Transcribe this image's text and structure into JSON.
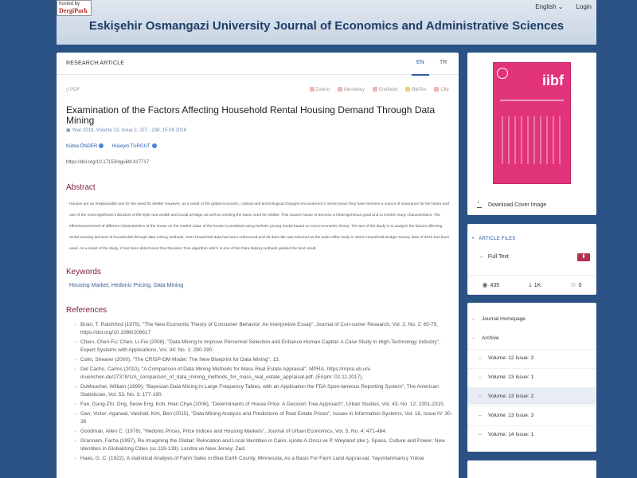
{
  "header": {
    "logo_line1": "hosted by",
    "logo_line2": "DergiPark",
    "journal_title": "Eskişehir Osmangazi University Journal of Economics and Administrative Sciences",
    "language": "English",
    "login": "Login"
  },
  "article": {
    "type": "RESEARCH ARTICLE",
    "tab_en": "EN",
    "tab_tr": "TR",
    "pdf": "PDF",
    "cite_tools": [
      "Zotero",
      "Mendeley",
      "EndNote",
      "BibTex",
      "Cite"
    ],
    "title": "Examination of the Factors Affecting Household Rental Housing Demand Through Data Mining",
    "meta": "Year 2018, Volume 13, Issue 2, 227 - 238, 15.08.2018",
    "authors": [
      "Kübra ÖNDER",
      "Hüseyin TURGUT"
    ],
    "doi": "https://doi.org/10.17153/oguiibf.417717",
    "abstract_heading": "Abstract",
    "abstract": "Houses are an irreplaceable tool for the need for shelter However, as a result of the global economic, cultural and technological changes encountered in recent years they have become a source of assurance for the future and one of the most significant indicators of life-style and wealth and social prestige as well as meeting the basic need for shelter. This causes house to become a heterogeneous good and to involve many characteristics. The effectiveness level of different characteristics of the house on the market value of the house is predicted using hedonic pricing model based on micro-economic theory. The aim of the study is to analyze the factors affecting rental housing demand of households through data mining methods. 2341 household data has been referenced and 49 data title was selected as the basis ofthe study in which Household Budget Survey data of 2015 has been used. As a result of the study, it has been determined that Decision Tree algorithm which is one of the Data Mining methods yielded the best result.",
    "keywords_heading": "Keywords",
    "keywords": "Housing Market, Hedonic Pricing, Data Mining",
    "references_heading": "References",
    "references": [
      "Brian, T. Ratchford (1975), \"The New Economic Theory of Consumer Behavior: An Interpretive Essay\", Journal of Con-sumer Research, Vol. 2, No. 2: 65-75, https://doi.org/10.1086/208617",
      "Chien, Chen-Fu; Chen, Li-Fei (2008), \"Data Mining to Improve Personnel Selection and Enhance Human Capital: A Case Study in High-Technology Industry\", Expert Systems with Applications, Vol. 34: No. 1: 280-290.",
      "Colin, Shearer (2000), \"The CRISP-DM Model: The New Blueprint for Data Mining\", 13.",
      "Del Cacho, Carlos (2010), \"A Comparison of Data Mining Methods for Mass Real Estate Appraisal\", MPRA, https://mpra.ub.uni-muenchen.de/27378/1/A_comparison_of_data_mining_methods_for_mass_real_estate_appraisal.pdf, (Erişim: 02.11.2017).",
      "DuMouchel, William (1999), \"Bayesian Data Mining in Large Frequency Tables, with an Application the FDA Spon-taneous Reporting System\", The American Statistician, Vol. 53, No. 3: 177-190.",
      "Fan, Gang-Zhi; Ong, Seow Eng; Koh, Hian Chye (2006), \"Determinants of House Price: A Decision Tree Approach\", Urban Studies, Vol. 43, No. 12: 2301-2315.",
      "Gan, Victor; Agarwal, Vaishali; Kim, Ben (2015), \"Data Mining Analysis and Predictions of Real Estate Prices\", Issues in Information Systems, Vol. 16, Issue IV: 30-36",
      "Goodman, Allen C. (1978), \"Hedonic Prices, Price Indices and Housing Markets\", Journal of Urban Economics, Vol. 5, No. 4: 471-484.",
      "Grannam, Farha (1997), Re-Imagining the Global: Relocation and Local Identities in Cairo, içinde A.Oncü ve P. Weyland (der.), Space, Culture and Power: New Identities in Globalizing Cities (ss.119-139). Londra ve New Jersey: Zed.",
      "Haas, G. C. (1922), A statistical Analysis of Farm Sales in Blue Earth County, Minnesota, As a Basis For Farm Land Apprai-sal, Yayımlanmamış Yükse"
    ]
  },
  "sidebar": {
    "cover_text": "iibf",
    "download_cover": "Download Cover Image",
    "files_heading": "ARTICLE FILES",
    "full_text": "Full Text",
    "views": "435",
    "downloads": "1K",
    "favorites": "0",
    "nav": [
      "Journal Homepage",
      "Archive"
    ],
    "issues": [
      "Volume: 12 Issue: 3",
      "Volume: 13 Issue: 1",
      "Volume: 13 Issue: 2",
      "Volume: 13 Issue: 3",
      "Volume: 14 Issue: 1"
    ],
    "active_issue": "Volume: 13 Issue: 2"
  },
  "colors": {
    "background": "#2b5285",
    "accent": "#7b1d3a",
    "link": "#1e5aa8",
    "cover": "#e0337a"
  }
}
